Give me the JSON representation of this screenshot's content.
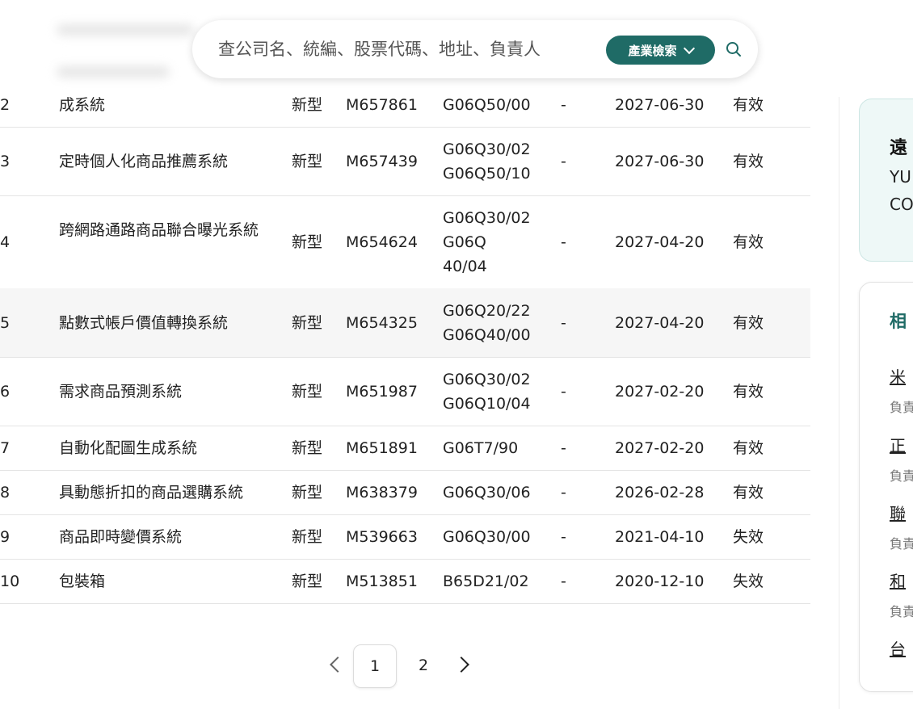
{
  "search": {
    "placeholder": "查公司名、統編、股票代碼、地址、負責人",
    "industry_button": "產業檢索"
  },
  "table": {
    "rows": [
      {
        "no": "2",
        "name": "成系統",
        "type": "新型",
        "number": "M657861",
        "ipc": [
          "G06Q50/00"
        ],
        "dash": "-",
        "date": "2027-06-30",
        "status": "有效"
      },
      {
        "no": "3",
        "name": "定時個人化商品推薦系統",
        "type": "新型",
        "number": "M657439",
        "ipc": [
          "G06Q30/02",
          "G06Q50/10"
        ],
        "dash": "-",
        "date": "2027-06-30",
        "status": "有效"
      },
      {
        "no": "4",
        "name": "跨網路通路商品聯合曝光系統",
        "type": "新型",
        "number": "M654624",
        "ipc": [
          "G06Q30/02",
          "G06Q",
          "40/04"
        ],
        "dash": "-",
        "date": "2027-04-20",
        "status": "有效"
      },
      {
        "no": "5",
        "name": "點數式帳戶價值轉換系統",
        "type": "新型",
        "number": "M654325",
        "ipc": [
          "G06Q20/22",
          "G06Q40/00"
        ],
        "dash": "-",
        "date": "2027-04-20",
        "status": "有效"
      },
      {
        "no": "6",
        "name": "需求商品預測系統",
        "type": "新型",
        "number": "M651987",
        "ipc": [
          "G06Q30/02",
          "G06Q10/04"
        ],
        "dash": "-",
        "date": "2027-02-20",
        "status": "有效"
      },
      {
        "no": "7",
        "name": "自動化配圖生成系統",
        "type": "新型",
        "number": "M651891",
        "ipc": [
          "G06T7/90"
        ],
        "dash": "-",
        "date": "2027-02-20",
        "status": "有效"
      },
      {
        "no": "8",
        "name": "具動態折扣的商品選購系統",
        "type": "新型",
        "number": "M638379",
        "ipc": [
          "G06Q30/06"
        ],
        "dash": "-",
        "date": "2026-02-28",
        "status": "有效"
      },
      {
        "no": "9",
        "name": "商品即時變價系統",
        "type": "新型",
        "number": "M539663",
        "ipc": [
          "G06Q30/00"
        ],
        "dash": "-",
        "date": "2021-04-10",
        "status": "失效"
      },
      {
        "no": "10",
        "name": "包裝箱",
        "type": "新型",
        "number": "M513851",
        "ipc": [
          "B65D21/02"
        ],
        "dash": "-",
        "date": "2020-12-10",
        "status": "失效"
      }
    ]
  },
  "pagination": {
    "pages": [
      "1",
      "2"
    ],
    "current": "1"
  },
  "side": {
    "card1": {
      "title": "遠",
      "lines": [
        "YU",
        "CO"
      ]
    },
    "card2": {
      "title": "相",
      "items": [
        {
          "label": "米",
          "sub": "負責"
        },
        {
          "label": "正",
          "sub": "負責"
        },
        {
          "label": "聯",
          "sub": "負責"
        },
        {
          "label": "和",
          "sub": "負責"
        },
        {
          "label": "台",
          "sub": ""
        }
      ]
    }
  },
  "colors": {
    "accent": "#1f6b66",
    "card_tint": "#eef8f7",
    "row_highlight": "#f6f6f6"
  }
}
